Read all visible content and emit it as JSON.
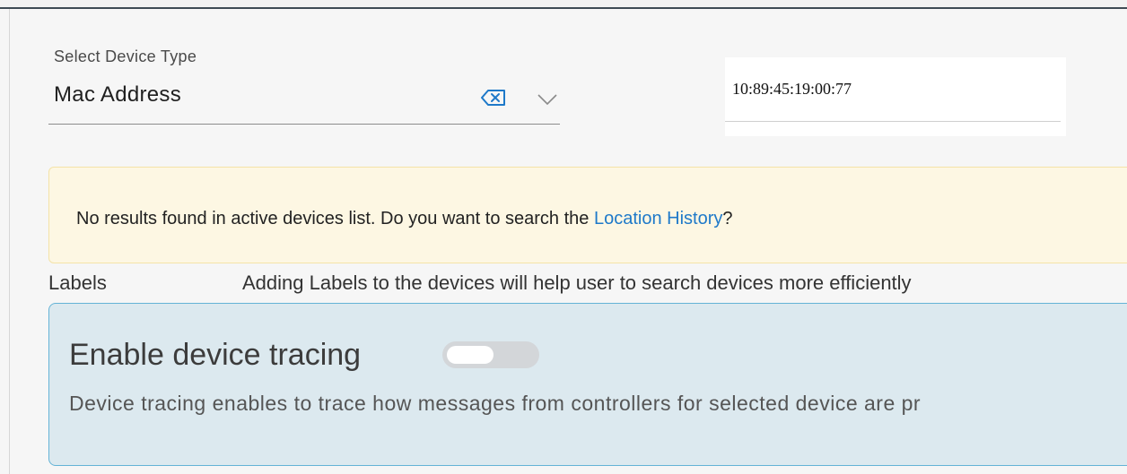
{
  "device_type": {
    "label": "Select Device Type",
    "selected_value": "Mac Address",
    "clear_icon": "backspace-clear-icon",
    "dropdown_icon": "chevron-down-icon"
  },
  "search": {
    "value": "10:89:45:19:00:77"
  },
  "alert": {
    "message": "No results found in active devices list. Do you want to search the ",
    "link_text": "Location History",
    "suffix": "?"
  },
  "labels": {
    "label": "Labels",
    "hint": "Adding Labels to the devices will help user to search devices more efficiently"
  },
  "tracing": {
    "title": "Enable device tracing",
    "enabled": false,
    "description": "Device tracing enables to trace how messages from controllers for selected device are pr"
  },
  "colors": {
    "accent": "#1e79c9",
    "alert_bg": "#fdf7e3",
    "panel_bg": "#dce9ef",
    "panel_border": "#64b3d6"
  }
}
